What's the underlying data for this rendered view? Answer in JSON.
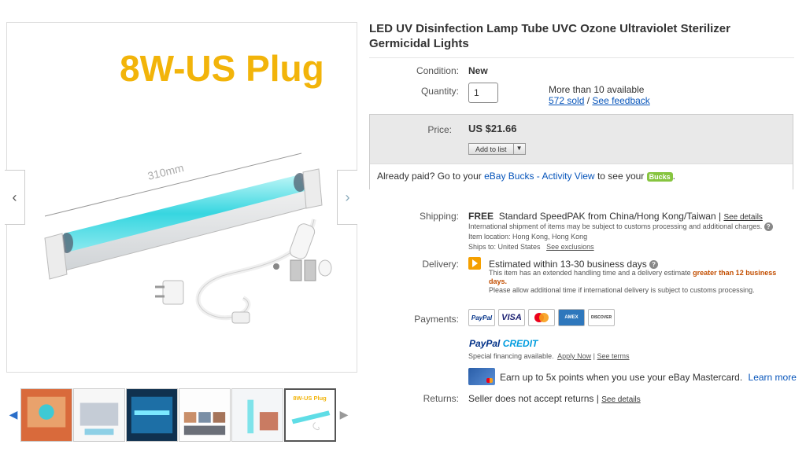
{
  "gallery": {
    "main_image_caption": "8W-US Plug",
    "main_image_dimension_label": "310mm",
    "prev_icon": "chevron-left-icon",
    "next_icon": "chevron-right-icon",
    "thumb_count": 6,
    "active_thumb_caption": "8W-US Plug"
  },
  "item": {
    "title": "LED UV Disinfection Lamp Tube UVC Ozone Ultraviolet Sterilizer Germicidal Lights"
  },
  "condition": {
    "label": "Condition:",
    "value": "New"
  },
  "quantity": {
    "label": "Quantity:",
    "value": "1",
    "available": "More than 10 available",
    "sold": "572 sold",
    "separator": "/",
    "feedback": "See feedback"
  },
  "price": {
    "label": "Price:",
    "value": "US $21.66",
    "add_to_list": "Add to list"
  },
  "already_paid": {
    "prefix": "Already paid? Go to your",
    "link": "eBay Bucks - Activity View",
    "suffix": "to see your",
    "badge": "Bucks",
    "end": "."
  },
  "shipping": {
    "label": "Shipping:",
    "free": "FREE",
    "method": "Standard SpeedPAK from China/Hong Kong/Taiwan |",
    "details_link": "See details",
    "note": "International shipment of items may be subject to customs processing and additional charges.",
    "item_location": "Item location:  Hong Kong, Hong Kong",
    "ships_to": "Ships to:  United States",
    "exclusions_link": "See exclusions"
  },
  "delivery": {
    "label": "Delivery:",
    "estimate": "Estimated within 13-30 business days",
    "note_prefix": "This item has an extended handling time and a delivery estimate",
    "note_highlight": "greater than 12 business days.",
    "note2": "Please allow additional time if international delivery is subject to customs processing."
  },
  "payments": {
    "label": "Payments:",
    "cards": [
      "PayPal",
      "VISA",
      "Mastercard",
      "AMEX",
      "DISCOVER"
    ],
    "paypal_credit_1": "PayPal",
    "paypal_credit_2": "CREDIT",
    "financing": "Special financing available.",
    "apply_now": "Apply Now",
    "sep": "|",
    "see_terms": "See terms",
    "mastercard_text": "Earn up to 5x points when you use your eBay Mastercard.",
    "learn_more": "Learn more"
  },
  "returns": {
    "label": "Returns:",
    "value": "Seller does not accept returns |",
    "details_link": "See details"
  },
  "colors": {
    "link": "#0654ba",
    "price_box_bg": "#e9e9e9",
    "warning_orange": "#f5a000",
    "highlight": "#c24e00",
    "caption_yellow": "#f2b40a"
  }
}
